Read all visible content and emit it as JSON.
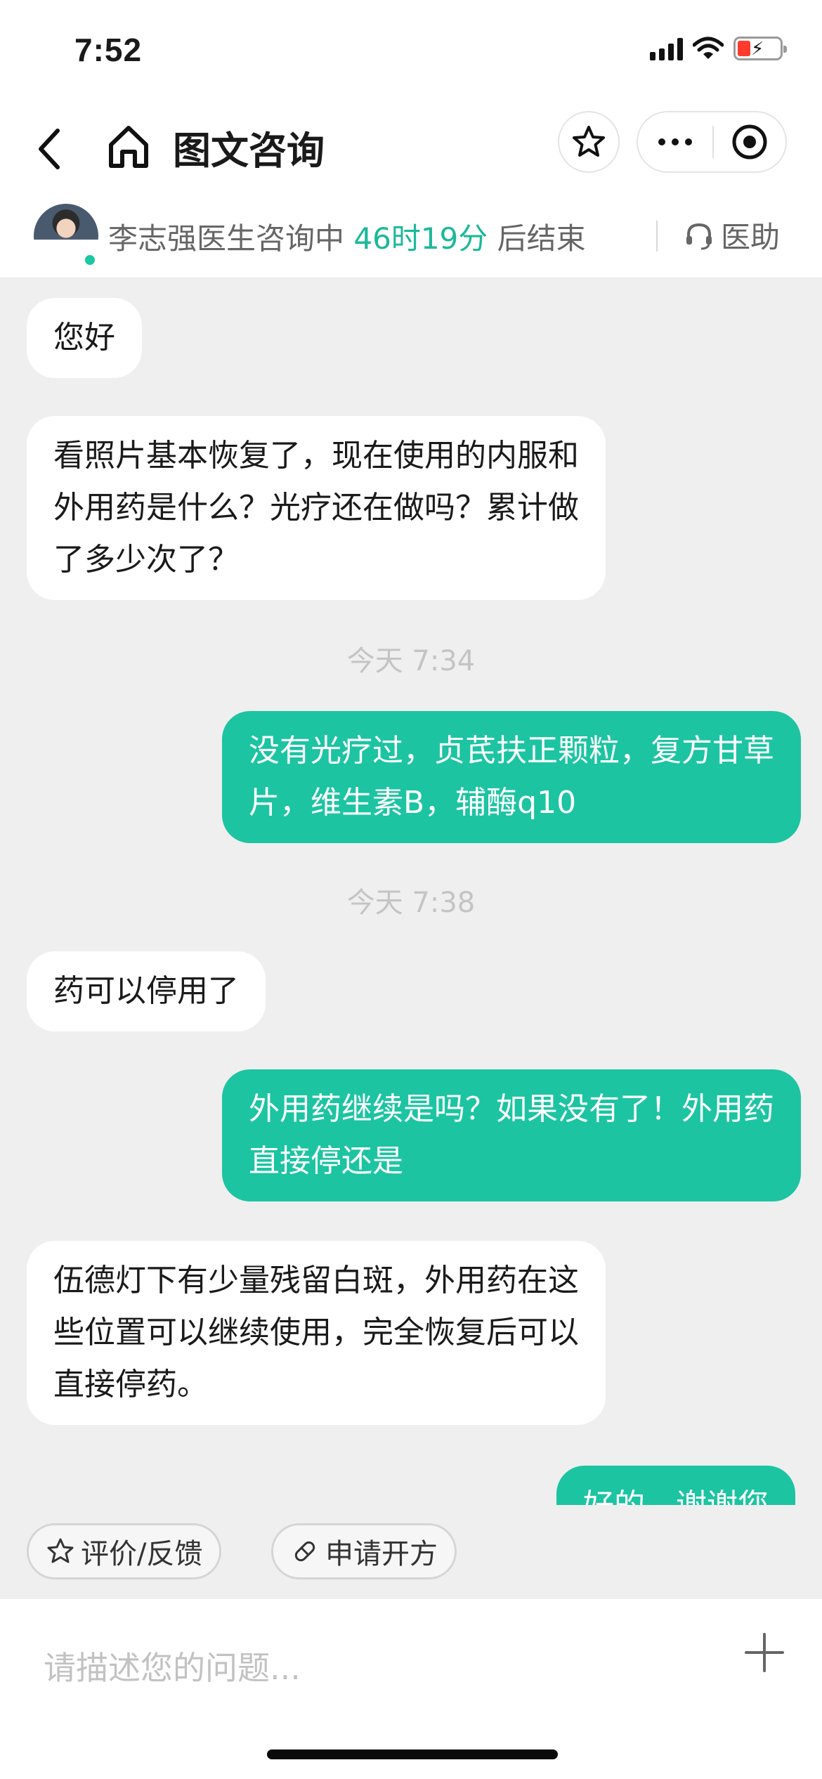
{
  "status_bar": {
    "time": "7:52"
  },
  "header": {
    "title": "图文咨询"
  },
  "doctor": {
    "status_prefix": "李志强医生咨询中",
    "time_left": "46时19分",
    "status_suffix": "后结束",
    "assistant_label": "医助"
  },
  "messages": [
    {
      "sender": "doctor",
      "text": "您好"
    },
    {
      "sender": "doctor",
      "lines": [
        "看照片基本恢复了，现在使用的内服和",
        "外用药是什么？光疗还在做吗？累计做",
        "了多少次了？"
      ]
    },
    {
      "type": "timestamp",
      "text": "今天 7:34"
    },
    {
      "sender": "patient",
      "lines": [
        "没有光疗过，贞芪扶正颗粒，复方甘草",
        "片，维生素B，辅酶q10"
      ]
    },
    {
      "type": "timestamp",
      "text": "今天 7:38"
    },
    {
      "sender": "doctor",
      "text": "药可以停用了"
    },
    {
      "sender": "patient",
      "lines": [
        "外用药继续是吗？如果没有了！外用药",
        "直接停还是"
      ]
    },
    {
      "sender": "doctor",
      "lines": [
        "伍德灯下有少量残留白斑，外用药在这",
        "些位置可以继续使用，完全恢复后可以",
        "直接停药。"
      ]
    },
    {
      "sender": "patient",
      "text": "好的，谢谢您"
    }
  ],
  "quick_actions": {
    "review_label": "评价/反馈",
    "prescription_label": "申请开方"
  },
  "input": {
    "placeholder": "请描述您的问题..."
  },
  "colors": {
    "accent": "#1cc4a2",
    "background": "#efefef"
  }
}
